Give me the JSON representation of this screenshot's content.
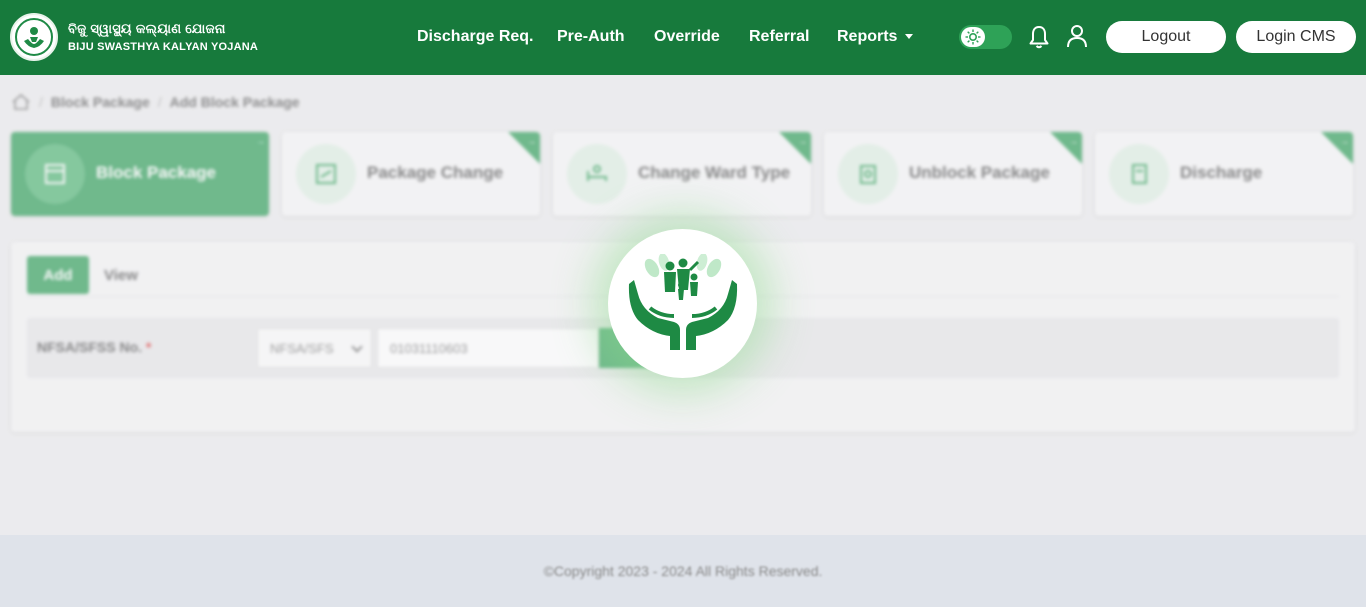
{
  "brand": {
    "name_odia": "ବିଜୁ ସ୍ୱାସ୍ଥ୍ୟ କଲ୍ୟାଣ ଯୋଜନା",
    "name_en": "BIJU SWASTHYA KALYAN YOJANA"
  },
  "nav": {
    "items": [
      "Discharge Req.",
      "Pre-Auth",
      "Override",
      "Referral",
      "Reports"
    ]
  },
  "header_buttons": {
    "logout": "Logout",
    "login_cms": "Login CMS"
  },
  "breadcrumb": [
    "Block Package",
    "Add Block Package"
  ],
  "cards": [
    {
      "label": "Block Package",
      "active": true
    },
    {
      "label": "Package Change",
      "active": false
    },
    {
      "label": "Change Ward Type",
      "active": false
    },
    {
      "label": "Unblock Package",
      "active": false
    },
    {
      "label": "Discharge",
      "active": false
    }
  ],
  "tabs": {
    "add": "Add",
    "view": "View"
  },
  "form": {
    "label": "NFSA/SFSS No.",
    "required_mark": "*",
    "select_value": "NFSA/SFS",
    "input_value": "01031110603"
  },
  "footer": {
    "copyright": "©Copyright 2023 - 2024 All Rights Reserved."
  },
  "colors": {
    "primary": "#177a3c",
    "accent": "#2e9e58"
  }
}
